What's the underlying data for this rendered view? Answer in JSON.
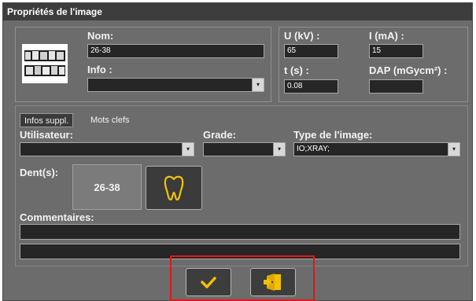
{
  "window": {
    "title": "Propriétés de l'image"
  },
  "image_info": {
    "nom_label": "Nom:",
    "nom_value": "26-38",
    "info_label": "Info :",
    "info_value": ""
  },
  "exposure": {
    "u_label": "U (kV) :",
    "u_value": "65",
    "i_label": "I (mA) :",
    "i_value": "15",
    "t_label": "t (s) :",
    "t_value": "0.08",
    "dap_label": "DAP (mGycm²) :",
    "dap_value": ""
  },
  "tabs": [
    {
      "label": "Infos suppl.",
      "active": true
    },
    {
      "label": "Mots clefs",
      "active": false
    }
  ],
  "form": {
    "utilisateur_label": "Utilisateur:",
    "utilisateur_value": "",
    "grade_label": "Grade:",
    "grade_value": "",
    "type_label": "Type de l'image:",
    "type_value": "IO;XRAY;",
    "dents_label": "Dent(s):",
    "dents_value": "26-38",
    "commentaires_label": "Commentaires:",
    "comment_line1": "",
    "comment_line2": ""
  },
  "icons": {
    "combo_arrow": "▾",
    "tooth": "tooth-icon",
    "confirm": "checkmark-icon",
    "exit": "door-exit-icon"
  },
  "colors": {
    "accent_yellow": "#f2c200",
    "highlight_red": "#e01818"
  }
}
